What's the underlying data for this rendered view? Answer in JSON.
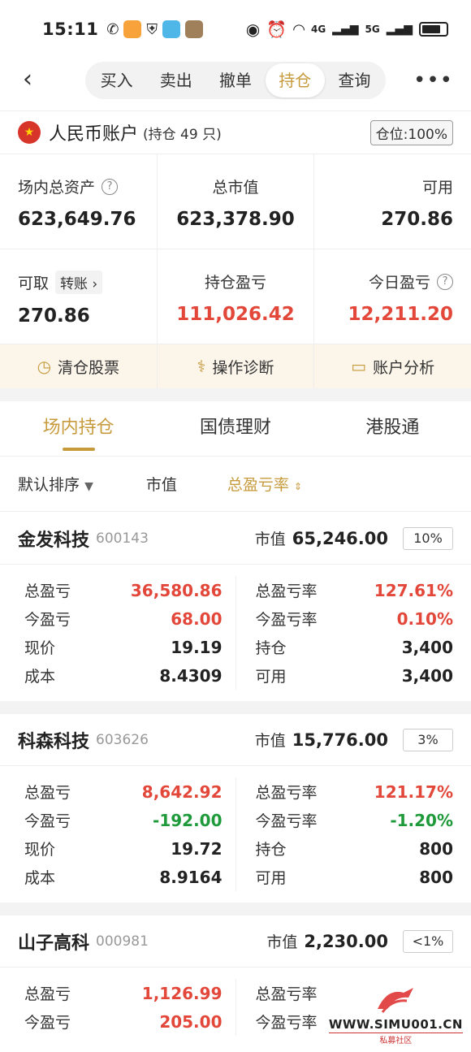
{
  "status_bar": {
    "time": "15:11",
    "net1": "4G",
    "net2": "5G"
  },
  "nav": {
    "tabs": [
      {
        "label": "买入"
      },
      {
        "label": "卖出"
      },
      {
        "label": "撤单"
      },
      {
        "label": "持仓",
        "active": true
      },
      {
        "label": "查询"
      }
    ]
  },
  "account": {
    "title": "人民币账户",
    "subtitle": "(持仓 49 只)",
    "position_badge": "仓位:100%"
  },
  "summary": {
    "total_assets_label": "场内总资产",
    "total_assets": "623,649.76",
    "market_value_label": "总市值",
    "market_value": "623,378.90",
    "available_label": "可用",
    "available": "270.86",
    "withdrawable_label": "可取",
    "transfer_label": "转账",
    "withdrawable": "270.86",
    "position_pnl_label": "持仓盈亏",
    "position_pnl": "111,026.42",
    "today_pnl_label": "今日盈亏",
    "today_pnl": "12,211.20"
  },
  "actions": [
    {
      "label": "清仓股票",
      "icon": "clock-icon"
    },
    {
      "label": "操作诊断",
      "icon": "stethoscope-icon"
    },
    {
      "label": "账户分析",
      "icon": "chart-monitor-icon"
    }
  ],
  "holding_tabs": [
    {
      "label": "场内持仓",
      "active": true
    },
    {
      "label": "国债理财"
    },
    {
      "label": "港股通"
    }
  ],
  "sort": {
    "default": "默认排序",
    "market_value": "市值",
    "total_rate": "总盈亏率"
  },
  "stocks": [
    {
      "name": "金发科技",
      "code": "600143",
      "mv_label": "市值",
      "mv": "65,246.00",
      "pct": "10%",
      "total_pnl": "36,580.86",
      "total_rate": "127.61%",
      "today_pnl": "68.00",
      "today_rate": "0.10%",
      "today_sign": "red",
      "price": "19.19",
      "holding": "3,400",
      "cost": "8.4309",
      "available": "3,400"
    },
    {
      "name": "科森科技",
      "code": "603626",
      "mv_label": "市值",
      "mv": "15,776.00",
      "pct": "3%",
      "total_pnl": "8,642.92",
      "total_rate": "121.17%",
      "today_pnl": "-192.00",
      "today_rate": "-1.20%",
      "today_sign": "green",
      "price": "19.72",
      "holding": "800",
      "cost": "8.9164",
      "available": "800"
    },
    {
      "name": "山子高科",
      "code": "000981",
      "mv_label": "市值",
      "mv": "2,230.00",
      "pct": "<1%",
      "total_pnl": "1,126.99",
      "total_rate": "",
      "today_pnl": "205.00",
      "today_rate": "",
      "today_sign": "red"
    }
  ],
  "labels": {
    "total_pnl": "总盈亏",
    "total_rate": "总盈亏率",
    "today_pnl": "今盈亏",
    "today_rate": "今盈亏率",
    "price": "现价",
    "holding": "持仓",
    "cost": "成本",
    "available": "可用"
  },
  "watermark": {
    "text": "WWW.SIMU001.CN",
    "sub": "私募社区"
  },
  "colors": {
    "accent": "#c79a3c",
    "red": "#e2473a",
    "green": "#1f9a3a"
  }
}
